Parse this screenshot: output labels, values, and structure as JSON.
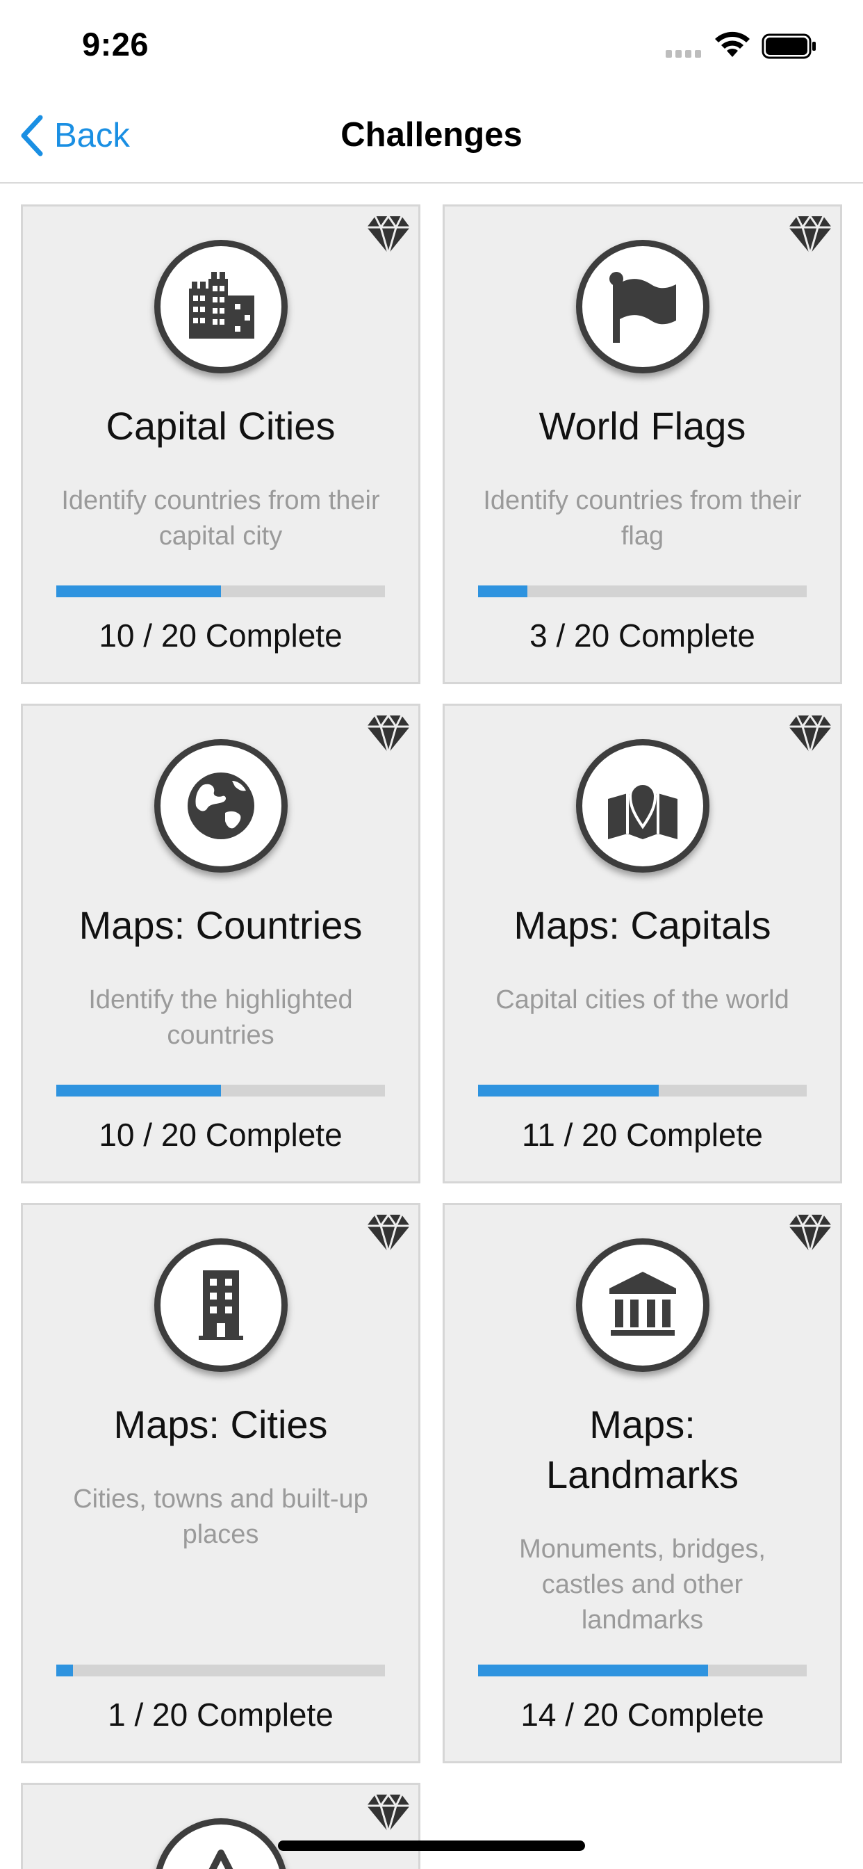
{
  "status_bar": {
    "time": "9:26"
  },
  "nav": {
    "back_label": "Back",
    "title": "Challenges"
  },
  "colors": {
    "accent": "#2e93df",
    "card_bg": "#eeeeee",
    "icon_dark": "#3d3d3d"
  },
  "challenges": [
    {
      "title": "Capital Cities",
      "description": "Identify countries from their capital city",
      "progress_text": "10 / 20 Complete",
      "completed": 10,
      "total": 20,
      "icon": "city-icon"
    },
    {
      "title": "World Flags",
      "description": "Identify countries from their flag",
      "progress_text": "3 / 20 Complete",
      "completed": 3,
      "total": 20,
      "icon": "flag-icon"
    },
    {
      "title": "Maps: Countries",
      "description": "Identify the highlighted countries",
      "progress_text": "10 / 20 Complete",
      "completed": 10,
      "total": 20,
      "icon": "globe-icon"
    },
    {
      "title": "Maps: Capitals",
      "description": "Capital cities of the world",
      "progress_text": "11 / 20 Complete",
      "completed": 11,
      "total": 20,
      "icon": "map-pin-icon"
    },
    {
      "title": "Maps: Cities",
      "description": "Cities, towns and built-up places",
      "progress_text": "1 / 20 Complete",
      "completed": 1,
      "total": 20,
      "icon": "building-icon"
    },
    {
      "title": "Maps: Landmarks",
      "description": "Monuments, bridges, castles and other landmarks",
      "progress_text": "14 / 20 Complete",
      "completed": 14,
      "total": 20,
      "icon": "landmark-icon"
    },
    {
      "icon": "mountain-icon"
    }
  ]
}
